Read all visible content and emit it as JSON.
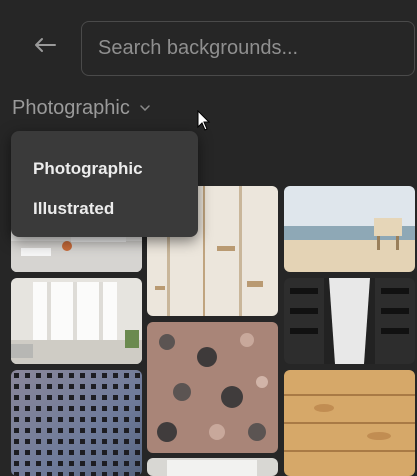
{
  "search": {
    "placeholder": "Search backgrounds..."
  },
  "category": {
    "selected": "Photographic"
  },
  "dropdown": {
    "options": [
      "Photographic",
      "Illustrated"
    ]
  },
  "icons": {
    "back": "arrow-left-icon",
    "chevron": "chevron-down-icon",
    "cursor": "mouse-pointer-icon"
  },
  "colors": {
    "background": "#262626",
    "menu": "#3a3a3a",
    "border": "#4a4a4a"
  }
}
